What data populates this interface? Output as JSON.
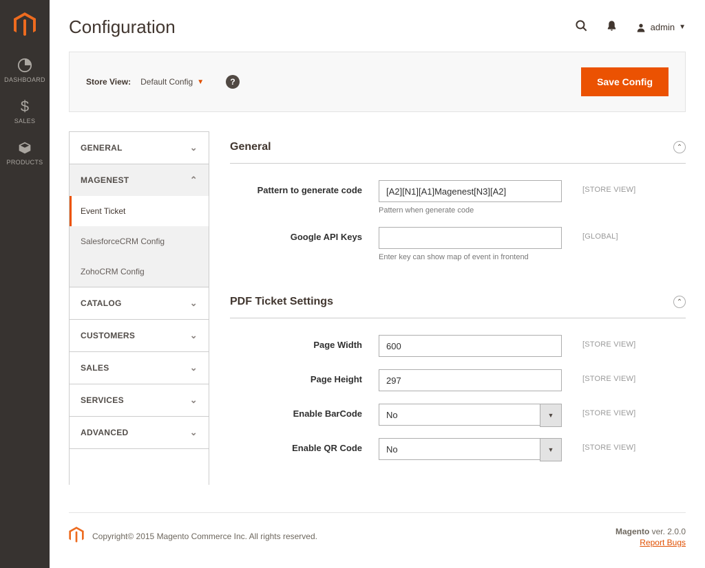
{
  "page_title": "Configuration",
  "header": {
    "user_label": "admin"
  },
  "toolbar": {
    "store_view_label": "Store View:",
    "store_view_value": "Default Config",
    "save_label": "Save Config"
  },
  "sidebar_nav": [
    {
      "id": "dashboard",
      "label": "DASHBOARD"
    },
    {
      "id": "sales",
      "label": "SALES"
    },
    {
      "id": "products",
      "label": "PRODUCTS"
    }
  ],
  "config_tabs": [
    {
      "id": "general",
      "label": "GENERAL",
      "expanded": false
    },
    {
      "id": "magenest",
      "label": "MAGENEST",
      "expanded": true,
      "items": [
        {
          "id": "event-ticket",
          "label": "Event Ticket",
          "active": true
        },
        {
          "id": "salesforcecrm",
          "label": "SalesforceCRM Config"
        },
        {
          "id": "zohocrm",
          "label": "ZohoCRM Config"
        }
      ]
    },
    {
      "id": "catalog",
      "label": "CATALOG",
      "expanded": false
    },
    {
      "id": "customers",
      "label": "CUSTOMERS",
      "expanded": false
    },
    {
      "id": "sales",
      "label": "SALES",
      "expanded": false
    },
    {
      "id": "services",
      "label": "SERVICES",
      "expanded": false
    },
    {
      "id": "advanced",
      "label": "ADVANCED",
      "expanded": false
    }
  ],
  "sections": {
    "general": {
      "title": "General",
      "fields": {
        "pattern": {
          "label": "Pattern to generate code",
          "value": "[A2][N1][A1]Magenest[N3][A2]",
          "hint": "Pattern when generate code",
          "scope": "[STORE VIEW]"
        },
        "google_api": {
          "label": "Google API Keys",
          "value": "",
          "hint": "Enter key can show map of event in frontend",
          "scope": "[GLOBAL]"
        }
      }
    },
    "pdf": {
      "title": "PDF Ticket Settings",
      "fields": {
        "page_width": {
          "label": "Page Width",
          "value": "600",
          "scope": "[STORE VIEW]"
        },
        "page_height": {
          "label": "Page Height",
          "value": "297",
          "scope": "[STORE VIEW]"
        },
        "enable_barcode": {
          "label": "Enable BarCode",
          "value": "No",
          "scope": "[STORE VIEW]"
        },
        "enable_qrcode": {
          "label": "Enable QR Code",
          "value": "No",
          "scope": "[STORE VIEW]"
        }
      }
    }
  },
  "footer": {
    "copyright": "Copyright© 2015 Magento Commerce Inc. All rights reserved.",
    "version_prefix": "Magento",
    "version": " ver. 2.0.0",
    "report_bugs": "Report Bugs"
  }
}
